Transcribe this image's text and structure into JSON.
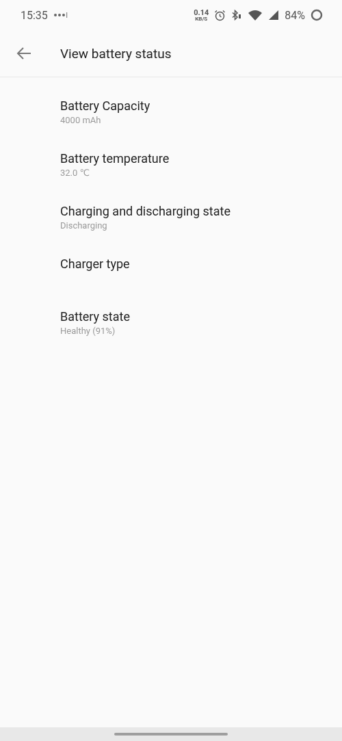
{
  "status_bar": {
    "time": "15:35",
    "net_speed": "0.14",
    "net_unit": "KB/S",
    "battery": "84%"
  },
  "app_bar": {
    "title": "View battery status"
  },
  "items": [
    {
      "title": "Battery Capacity",
      "value": "4000 mAh"
    },
    {
      "title": "Battery temperature",
      "value": "32.0 ℃"
    },
    {
      "title": "Charging and discharging state",
      "value": "Discharging"
    },
    {
      "title": "Charger type"
    },
    {
      "title": "Battery state",
      "value": "Healthy (91%)"
    }
  ]
}
